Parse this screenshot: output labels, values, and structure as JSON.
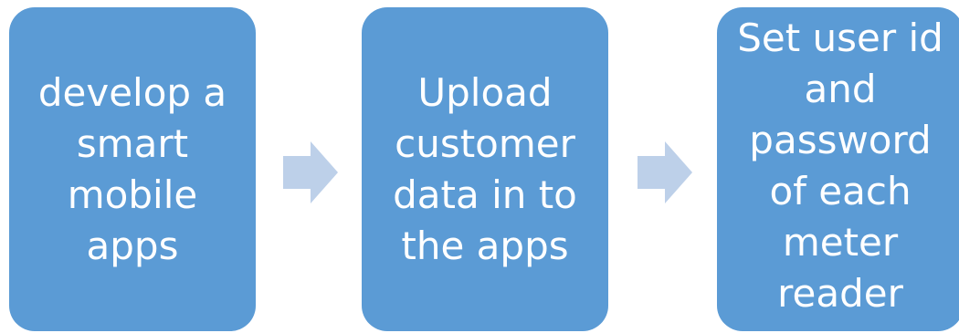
{
  "diagram": {
    "steps": [
      {
        "text": "develop a\nsmart\nmobile\napps"
      },
      {
        "text": "Upload\ncustomer\ndata in to\nthe apps"
      },
      {
        "text": "Set user id\nand\npassword\nof each\nmeter\nreader"
      }
    ],
    "colors": {
      "box_fill": "#5b9bd5",
      "box_text": "#ffffff",
      "arrow_fill": "#bdd0e9"
    }
  }
}
